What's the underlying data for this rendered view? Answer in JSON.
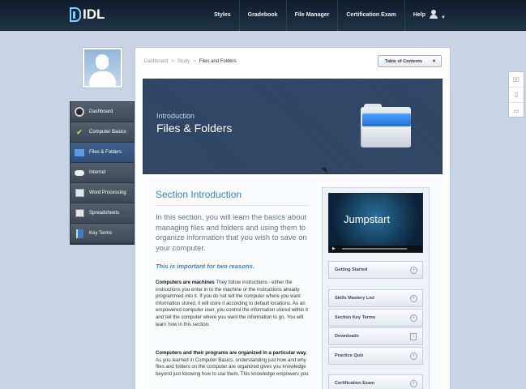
{
  "brand": {
    "logo_text": "IDL"
  },
  "topnav": {
    "items": [
      {
        "label": "Styles"
      },
      {
        "label": "Gradebook"
      },
      {
        "label": "File Manager"
      },
      {
        "label": "Certification Exam"
      },
      {
        "label": "Help"
      }
    ]
  },
  "sidebar": {
    "items": [
      {
        "label": "Dashboard",
        "icon": "dashboard-icon"
      },
      {
        "label": "Computer Basics",
        "icon": "check-icon"
      },
      {
        "label": "Files & Folders",
        "icon": "folder-icon",
        "active": true
      },
      {
        "label": "Internet",
        "icon": "cloud-icon"
      },
      {
        "label": "Word Processing",
        "icon": "document-icon"
      },
      {
        "label": "Spreadsheets",
        "icon": "spreadsheet-icon"
      },
      {
        "label": "Key Terms",
        "icon": "book-icon"
      }
    ]
  },
  "breadcrumb": {
    "items": [
      "Dashboard",
      ">",
      "Study",
      ">",
      "Files and Folders"
    ]
  },
  "toc": {
    "label": "Table of Contents"
  },
  "banner": {
    "kicker": "Introduction",
    "title": "Files & Folders"
  },
  "section": {
    "title": "Section Introduction",
    "lead": "In this section, you will learn the basics about managing files and folders and using them to organize information that you wish to save on your computer.",
    "important": "This is important for two reasons.",
    "p1_bold": "Computers are machines",
    "p1_text": " They follow instructions - either the instructions you enter in to the machine or the instructions already programmed into it. If you do not tell the computer where you want information stored, it will store it according to default locations. As an empowered computer user, you control the information stored within it and tell the computer where you want the information to go. You will learn how in this section.",
    "p2_bold": "Computers and their programs are organized in a particular way.",
    "p2_text": " As you learned in Computer Basics, understanding just how and why files and folders on the computer are organized gives you knowledge beyond just knowing how to use them. This knowledge empowers you"
  },
  "video": {
    "title": "Jumpstart"
  },
  "resources": {
    "items": [
      {
        "label": "Getting Started"
      },
      {
        "label": "Skills Mastery List"
      },
      {
        "label": "Section Key Terms"
      },
      {
        "label": "Downloads"
      },
      {
        "label": "Practice Quiz"
      },
      {
        "label": "Certification Exam"
      }
    ]
  },
  "colors": {
    "accent": "#3c84c2",
    "banner": "#2f4564",
    "topbar": "#162638"
  }
}
